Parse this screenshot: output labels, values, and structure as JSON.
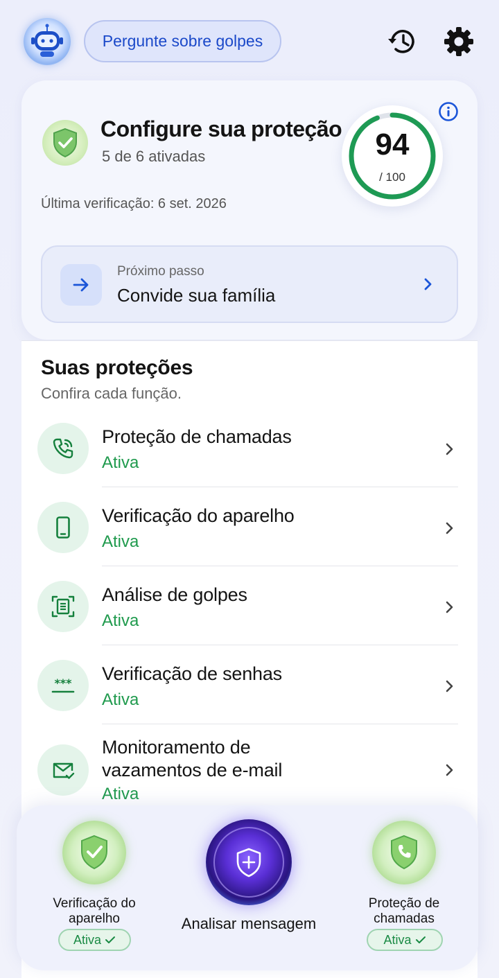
{
  "header": {
    "ask_label": "Pergunte sobre golpes",
    "icons": [
      "robot-avatar-icon",
      "history-icon",
      "gear-icon"
    ]
  },
  "protection": {
    "title": "Configure sua proteção",
    "subtitle": "5 de 6 ativadas",
    "last_check": "Última verificação: 6 set. 2026",
    "score": "94",
    "score_max": "/ 100",
    "score_fraction": 0.94,
    "next_step": {
      "label": "Próximo passo",
      "title": "Convide sua família"
    }
  },
  "protections": {
    "title": "Suas proteções",
    "subtitle": "Confira cada função.",
    "items": [
      {
        "name": "Proteção de chamadas",
        "status": "Ativa",
        "icon": "phone-call-icon"
      },
      {
        "name": "Verificação do aparelho",
        "status": "Ativa",
        "icon": "smartphone-icon"
      },
      {
        "name": "Análise de golpes",
        "status": "Ativa",
        "icon": "document-scan-icon"
      },
      {
        "name": "Verificação de senhas",
        "status": "Ativa",
        "icon": "password-icon"
      },
      {
        "name": "Monitoramento de vazamentos de e-mail",
        "name_line1": "Monitoramento de",
        "name_line2": "vazamentos de e-mail",
        "status": "Ativa",
        "icon": "mail-check-icon"
      }
    ]
  },
  "dock": {
    "left": {
      "line1": "Verificação do",
      "line2": "aparelho",
      "badge": "Ativa"
    },
    "center": {
      "label": "Analisar mensagem"
    },
    "right": {
      "line1": "Proteção de",
      "line2": "chamadas",
      "badge": "Ativa"
    }
  },
  "colors": {
    "accent_blue": "#1b49c9",
    "active_green": "#1f9a4d",
    "score_ring": "#1e9a54"
  }
}
